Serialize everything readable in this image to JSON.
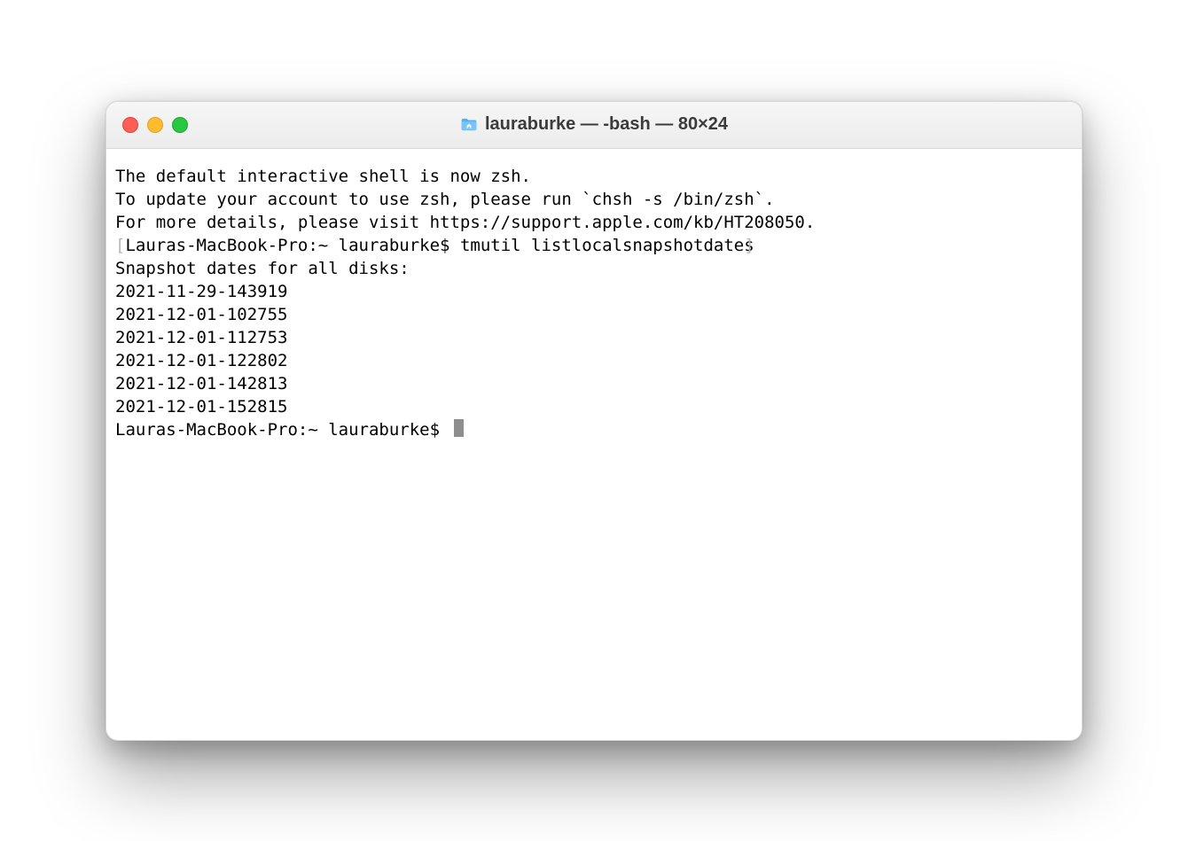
{
  "window": {
    "title": "lauraburke — -bash — 80×24",
    "buttons": {
      "close": "close",
      "min": "minimize",
      "max": "maximize"
    }
  },
  "terminal": {
    "intro": [
      "The default interactive shell is now zsh.",
      "To update your account to use zsh, please run `chsh -s /bin/zsh`.",
      "For more details, please visit https://support.apple.com/kb/HT208050."
    ],
    "prompt1_prefix": "Lauras-MacBook-Pro:~ lauraburke$ ",
    "command1": "tmutil listlocalsnapshotdates",
    "output_header": "Snapshot dates for all disks:",
    "snapshot_dates": [
      "2021-11-29-143919",
      "2021-12-01-102755",
      "2021-12-01-112753",
      "2021-12-01-122802",
      "2021-12-01-142813",
      "2021-12-01-152815"
    ],
    "prompt2": "Lauras-MacBook-Pro:~ lauraburke$ "
  }
}
